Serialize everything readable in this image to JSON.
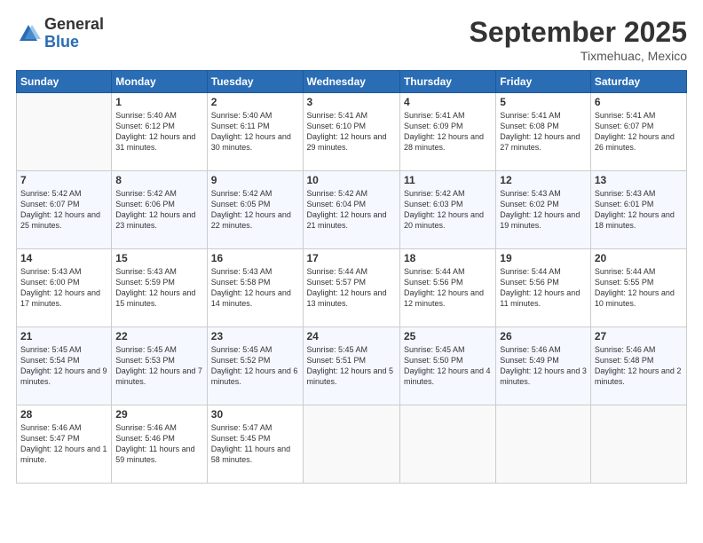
{
  "header": {
    "logo_general": "General",
    "logo_blue": "Blue",
    "month_title": "September 2025",
    "location": "Tixmehuac, Mexico"
  },
  "days_of_week": [
    "Sunday",
    "Monday",
    "Tuesday",
    "Wednesday",
    "Thursday",
    "Friday",
    "Saturday"
  ],
  "weeks": [
    [
      {
        "day": "",
        "info": ""
      },
      {
        "day": "1",
        "info": "Sunrise: 5:40 AM\nSunset: 6:12 PM\nDaylight: 12 hours\nand 31 minutes."
      },
      {
        "day": "2",
        "info": "Sunrise: 5:40 AM\nSunset: 6:11 PM\nDaylight: 12 hours\nand 30 minutes."
      },
      {
        "day": "3",
        "info": "Sunrise: 5:41 AM\nSunset: 6:10 PM\nDaylight: 12 hours\nand 29 minutes."
      },
      {
        "day": "4",
        "info": "Sunrise: 5:41 AM\nSunset: 6:09 PM\nDaylight: 12 hours\nand 28 minutes."
      },
      {
        "day": "5",
        "info": "Sunrise: 5:41 AM\nSunset: 6:08 PM\nDaylight: 12 hours\nand 27 minutes."
      },
      {
        "day": "6",
        "info": "Sunrise: 5:41 AM\nSunset: 6:07 PM\nDaylight: 12 hours\nand 26 minutes."
      }
    ],
    [
      {
        "day": "7",
        "info": "Sunrise: 5:42 AM\nSunset: 6:07 PM\nDaylight: 12 hours\nand 25 minutes."
      },
      {
        "day": "8",
        "info": "Sunrise: 5:42 AM\nSunset: 6:06 PM\nDaylight: 12 hours\nand 23 minutes."
      },
      {
        "day": "9",
        "info": "Sunrise: 5:42 AM\nSunset: 6:05 PM\nDaylight: 12 hours\nand 22 minutes."
      },
      {
        "day": "10",
        "info": "Sunrise: 5:42 AM\nSunset: 6:04 PM\nDaylight: 12 hours\nand 21 minutes."
      },
      {
        "day": "11",
        "info": "Sunrise: 5:42 AM\nSunset: 6:03 PM\nDaylight: 12 hours\nand 20 minutes."
      },
      {
        "day": "12",
        "info": "Sunrise: 5:43 AM\nSunset: 6:02 PM\nDaylight: 12 hours\nand 19 minutes."
      },
      {
        "day": "13",
        "info": "Sunrise: 5:43 AM\nSunset: 6:01 PM\nDaylight: 12 hours\nand 18 minutes."
      }
    ],
    [
      {
        "day": "14",
        "info": "Sunrise: 5:43 AM\nSunset: 6:00 PM\nDaylight: 12 hours\nand 17 minutes."
      },
      {
        "day": "15",
        "info": "Sunrise: 5:43 AM\nSunset: 5:59 PM\nDaylight: 12 hours\nand 15 minutes."
      },
      {
        "day": "16",
        "info": "Sunrise: 5:43 AM\nSunset: 5:58 PM\nDaylight: 12 hours\nand 14 minutes."
      },
      {
        "day": "17",
        "info": "Sunrise: 5:44 AM\nSunset: 5:57 PM\nDaylight: 12 hours\nand 13 minutes."
      },
      {
        "day": "18",
        "info": "Sunrise: 5:44 AM\nSunset: 5:56 PM\nDaylight: 12 hours\nand 12 minutes."
      },
      {
        "day": "19",
        "info": "Sunrise: 5:44 AM\nSunset: 5:56 PM\nDaylight: 12 hours\nand 11 minutes."
      },
      {
        "day": "20",
        "info": "Sunrise: 5:44 AM\nSunset: 5:55 PM\nDaylight: 12 hours\nand 10 minutes."
      }
    ],
    [
      {
        "day": "21",
        "info": "Sunrise: 5:45 AM\nSunset: 5:54 PM\nDaylight: 12 hours\nand 9 minutes."
      },
      {
        "day": "22",
        "info": "Sunrise: 5:45 AM\nSunset: 5:53 PM\nDaylight: 12 hours\nand 7 minutes."
      },
      {
        "day": "23",
        "info": "Sunrise: 5:45 AM\nSunset: 5:52 PM\nDaylight: 12 hours\nand 6 minutes."
      },
      {
        "day": "24",
        "info": "Sunrise: 5:45 AM\nSunset: 5:51 PM\nDaylight: 12 hours\nand 5 minutes."
      },
      {
        "day": "25",
        "info": "Sunrise: 5:45 AM\nSunset: 5:50 PM\nDaylight: 12 hours\nand 4 minutes."
      },
      {
        "day": "26",
        "info": "Sunrise: 5:46 AM\nSunset: 5:49 PM\nDaylight: 12 hours\nand 3 minutes."
      },
      {
        "day": "27",
        "info": "Sunrise: 5:46 AM\nSunset: 5:48 PM\nDaylight: 12 hours\nand 2 minutes."
      }
    ],
    [
      {
        "day": "28",
        "info": "Sunrise: 5:46 AM\nSunset: 5:47 PM\nDaylight: 12 hours\nand 1 minute."
      },
      {
        "day": "29",
        "info": "Sunrise: 5:46 AM\nSunset: 5:46 PM\nDaylight: 11 hours\nand 59 minutes."
      },
      {
        "day": "30",
        "info": "Sunrise: 5:47 AM\nSunset: 5:45 PM\nDaylight: 11 hours\nand 58 minutes."
      },
      {
        "day": "",
        "info": ""
      },
      {
        "day": "",
        "info": ""
      },
      {
        "day": "",
        "info": ""
      },
      {
        "day": "",
        "info": ""
      }
    ]
  ]
}
